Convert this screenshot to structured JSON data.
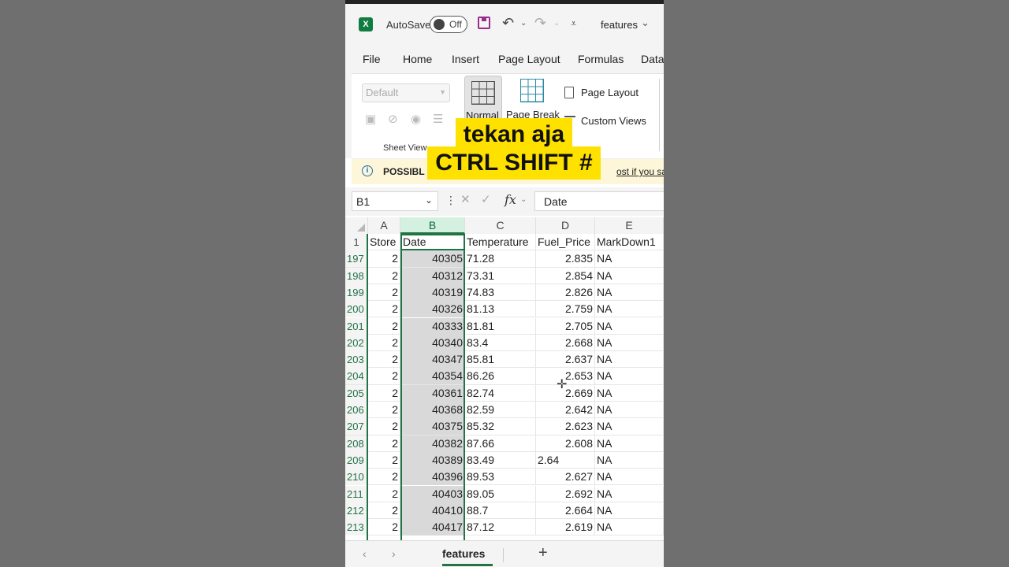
{
  "titlebar": {
    "app_logo": "X",
    "autosave_label": "AutoSave",
    "autosave_state": "Off",
    "doc_name": "features",
    "icons": [
      "excel-icon",
      "save-icon",
      "undo-icon",
      "redo-icon",
      "customize-qat-icon",
      "chevron-down-icon"
    ]
  },
  "menu": {
    "tabs": [
      "File",
      "Home",
      "Insert",
      "Page Layout",
      "Formulas",
      "Data"
    ]
  },
  "ribbon": {
    "sheet_view_dropdown": "Default",
    "sheet_view_label": "Sheet View",
    "normal_label": "Normal",
    "page_break_label": "Page Break",
    "page_layout_label": "Page Layout",
    "custom_views_label": "Custom Views"
  },
  "infobar": {
    "text": "POSSIBL",
    "link": "ost if you sa"
  },
  "formula_bar": {
    "name_box": "B1",
    "fx": "fx",
    "value": "Date"
  },
  "grid": {
    "columns": [
      "A",
      "B",
      "C",
      "D",
      "E"
    ],
    "header_row": {
      "row_number": "1",
      "cells": [
        "Store",
        "Date",
        "Temperature",
        "Fuel_Price",
        "MarkDown1"
      ]
    },
    "rows": [
      {
        "n": "197",
        "store": "2",
        "date": "40305",
        "temp": "71.28",
        "fuel": "2.835",
        "md1": "NA"
      },
      {
        "n": "198",
        "store": "2",
        "date": "40312",
        "temp": "73.31",
        "fuel": "2.854",
        "md1": "NA"
      },
      {
        "n": "199",
        "store": "2",
        "date": "40319",
        "temp": "74.83",
        "fuel": "2.826",
        "md1": "NA"
      },
      {
        "n": "200",
        "store": "2",
        "date": "40326",
        "temp": "81.13",
        "fuel": "2.759",
        "md1": "NA"
      },
      {
        "n": "201",
        "store": "2",
        "date": "40333",
        "temp": "81.81",
        "fuel": "2.705",
        "md1": "NA"
      },
      {
        "n": "202",
        "store": "2",
        "date": "40340",
        "temp": "83.4",
        "fuel": "2.668",
        "md1": "NA"
      },
      {
        "n": "203",
        "store": "2",
        "date": "40347",
        "temp": "85.81",
        "fuel": "2.637",
        "md1": "NA"
      },
      {
        "n": "204",
        "store": "2",
        "date": "40354",
        "temp": "86.26",
        "fuel": "2.653",
        "md1": "NA"
      },
      {
        "n": "205",
        "store": "2",
        "date": "40361",
        "temp": "82.74",
        "fuel": "2.669",
        "md1": "NA"
      },
      {
        "n": "206",
        "store": "2",
        "date": "40368",
        "temp": "82.59",
        "fuel": "2.642",
        "md1": "NA"
      },
      {
        "n": "207",
        "store": "2",
        "date": "40375",
        "temp": "85.32",
        "fuel": "2.623",
        "md1": "NA"
      },
      {
        "n": "208",
        "store": "2",
        "date": "40382",
        "temp": "87.66",
        "fuel": "2.608",
        "md1": "NA"
      },
      {
        "n": "209",
        "store": "2",
        "date": "40389",
        "temp": "83.49",
        "fuel": "2.64",
        "md1": "NA"
      },
      {
        "n": "210",
        "store": "2",
        "date": "40396",
        "temp": "89.53",
        "fuel": "2.627",
        "md1": "NA"
      },
      {
        "n": "211",
        "store": "2",
        "date": "40403",
        "temp": "89.05",
        "fuel": "2.692",
        "md1": "NA"
      },
      {
        "n": "212",
        "store": "2",
        "date": "40410",
        "temp": "88.7",
        "fuel": "2.664",
        "md1": "NA"
      },
      {
        "n": "213",
        "store": "2",
        "date": "40417",
        "temp": "87.12",
        "fuel": "2.619",
        "md1": "NA"
      }
    ],
    "left_aligned_fuel_row": "209"
  },
  "sheet_tabs": {
    "active": "features",
    "add_label": "+"
  },
  "caption": {
    "line1": "tekan aja",
    "line2": "CTRL SHIFT #"
  },
  "colors": {
    "excel_green": "#217346",
    "caption_yellow": "#ffe100",
    "save_purple": "#9b2d8a",
    "info_bg": "#fdf6d8",
    "selected_column_fill": "#d9d9d9"
  }
}
